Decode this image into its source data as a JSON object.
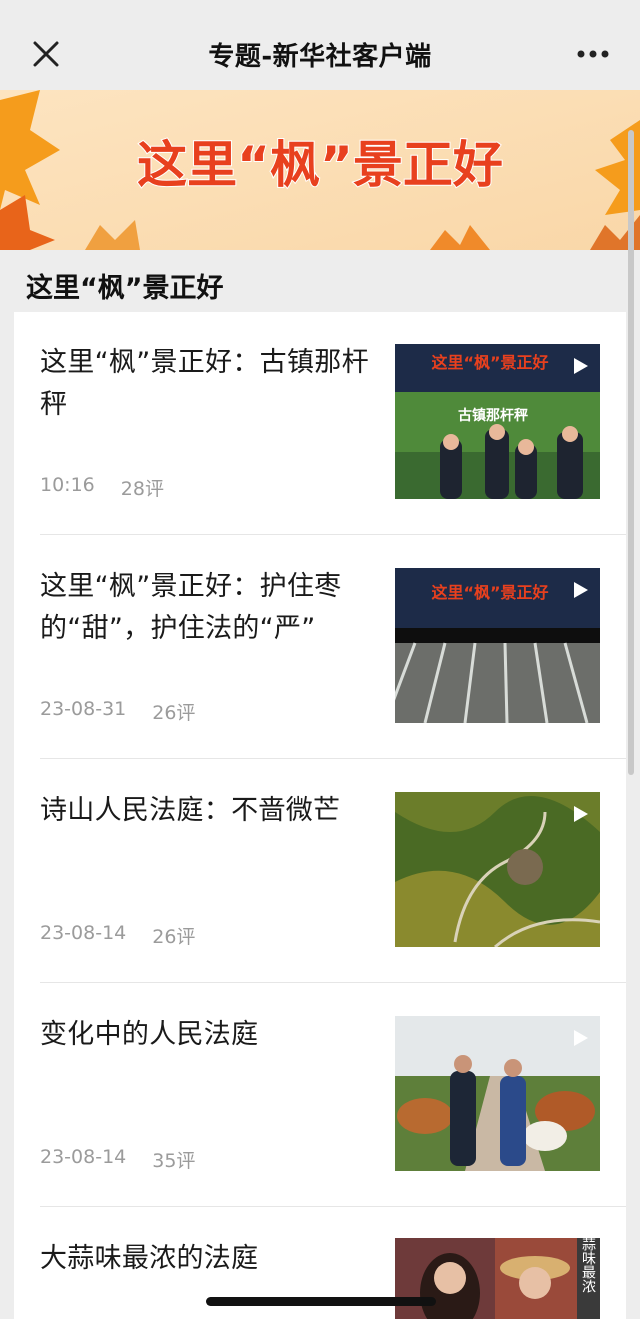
{
  "nav": {
    "title": "专题-新华社客户端",
    "close_icon": "close-icon",
    "more_icon": "more-dots-icon"
  },
  "banner": {
    "text": "这里“枫”景正好",
    "colors": {
      "text": "#e8401e",
      "bg": "#fbe3bf",
      "leaf": "#f28a1a"
    }
  },
  "section": {
    "title": "这里“枫”景正好"
  },
  "articles": [
    {
      "title": "这里“枫”景正好：古镇那杆秤",
      "time": "10:16",
      "comments": "28评",
      "thumb_logo": "这里“枫”景正好",
      "thumb_caption": "古镇那杆秤"
    },
    {
      "title": "这里“枫”景正好：护住枣的“甜”，护住法的“严”",
      "time": "23-08-31",
      "comments": "26评",
      "thumb_logo": "这里“枫”景正好"
    },
    {
      "title": "诗山人民法庭：不啬微芒",
      "time": "23-08-14",
      "comments": "26评"
    },
    {
      "title": "变化中的人民法庭",
      "time": "23-08-14",
      "comments": "35评"
    },
    {
      "title": "大蒜味最浓的法庭",
      "time": "",
      "comments": "",
      "thumb_side_text": "大蒜味最浓"
    }
  ]
}
